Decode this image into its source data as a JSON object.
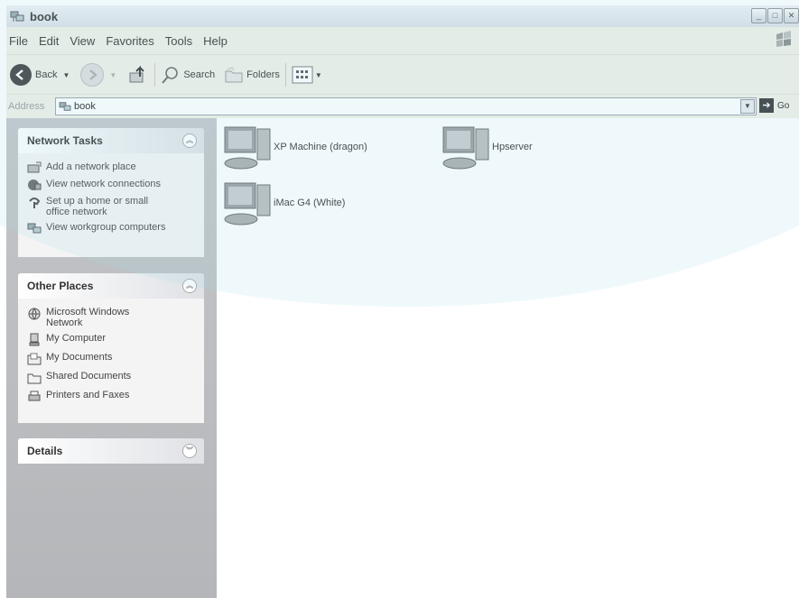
{
  "window": {
    "title": "book"
  },
  "menu": [
    "File",
    "Edit",
    "View",
    "Favorites",
    "Tools",
    "Help"
  ],
  "toolbar": {
    "back_label": "Back",
    "search_label": "Search",
    "folders_label": "Folders"
  },
  "address": {
    "label": "Address",
    "value": "book",
    "go_label": "Go"
  },
  "sidebar": {
    "network_tasks": {
      "title": "Network Tasks",
      "items": [
        "Add a network place",
        "View network connections",
        "Set up a home or small office network",
        "View workgroup computers"
      ]
    },
    "other_places": {
      "title": "Other Places",
      "items": [
        "Microsoft Windows Network",
        "My Computer",
        "My Documents",
        "Shared Documents",
        "Printers and Faxes"
      ]
    },
    "details": {
      "title": "Details"
    }
  },
  "computers": [
    {
      "name": "XP Machine (dragon)"
    },
    {
      "name": "Hpserver"
    },
    {
      "name": "iMac G4 (White)"
    }
  ],
  "icons": {
    "window": "network-folder-icon",
    "computer": "computer-icon"
  }
}
